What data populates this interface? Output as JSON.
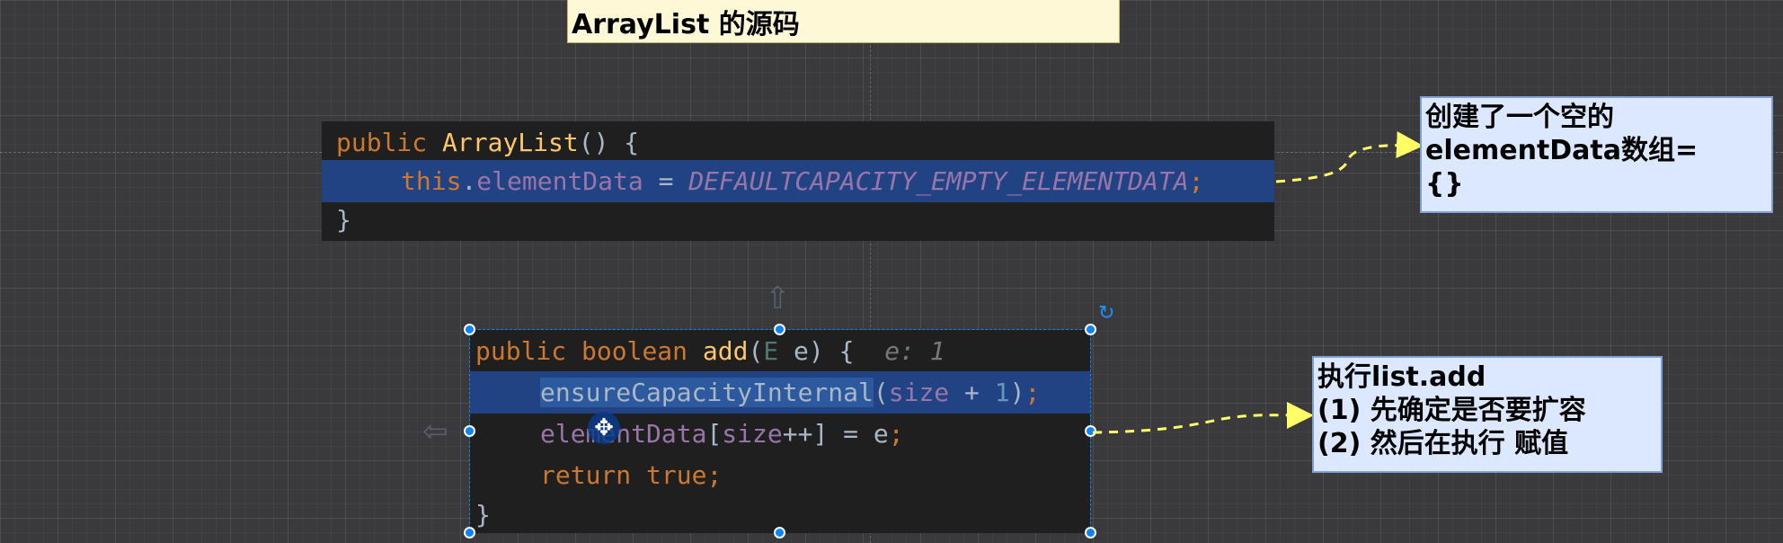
{
  "title": "ArrayList 的源码",
  "code_block_1": {
    "line1": {
      "kw": "public",
      "name": "ArrayList",
      "rest": "() {"
    },
    "line2": {
      "kw": "this",
      "dot": ".",
      "field": "elementData",
      "eq": " = ",
      "const": "DEFAULTCAPACITY_EMPTY_ELEMENTDATA",
      "semi": ";"
    },
    "line3": "}"
  },
  "code_block_2": {
    "line1": {
      "kw1": "public",
      "kw2": "boolean",
      "name": "add",
      "open": "(",
      "type": "E",
      "param": " e) {",
      "hint": "e: 1"
    },
    "line2": {
      "call": "ensureCapacityInternal",
      "open": "(",
      "field": "size",
      "op": " + ",
      "num": "1",
      "close": ")",
      "semi": ";"
    },
    "line3": {
      "field": "elementData",
      "open": "[",
      "field2": "size",
      "rest": "++] = e",
      "semi": ";"
    },
    "line4": {
      "kw1": "return",
      "kw2": "true",
      "semi": ";"
    },
    "line5": "}"
  },
  "note_1": {
    "lines": [
      "创建了一个空的",
      "elementData数组=",
      "{}"
    ]
  },
  "note_2": {
    "lines": [
      "执行list.add",
      "(1) 先确定是否要扩容",
      "(2) 然后在执行 赋值"
    ]
  },
  "icons": {
    "rotate": "rotate-icon",
    "move": "move-icon"
  },
  "colors": {
    "keyword": "#cc7832",
    "method": "#ffc66d",
    "field": "#9876aa",
    "number": "#6897bb",
    "selection": "#214283",
    "note_bg": "#dce8ff",
    "title_bg": "#fff8d6",
    "handle": "#0a84ff",
    "connector": "#ffff66"
  }
}
